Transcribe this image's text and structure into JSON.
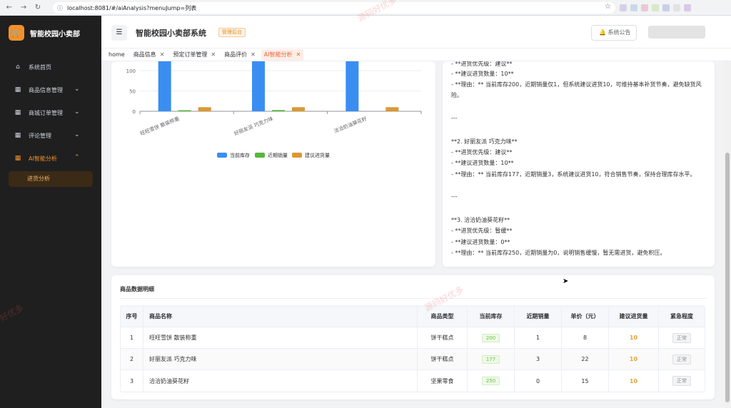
{
  "browser": {
    "url": "localhost:8081/#/aiAnalysis?menuJump=列表"
  },
  "sidebar": {
    "brand": "智能校园小卖部",
    "items": [
      {
        "label": "系统首页",
        "icon": "home-icon"
      },
      {
        "label": "商品信息管理",
        "icon": "grid-icon"
      },
      {
        "label": "商城订单管理",
        "icon": "grid-icon"
      },
      {
        "label": "评论管理",
        "icon": "grid-icon"
      },
      {
        "label": "AI智能分析",
        "icon": "grid-icon"
      }
    ],
    "sub_item": "进货分析"
  },
  "header": {
    "title": "智能校园小卖部系统",
    "badge": "管理后台",
    "notice": "系统公告"
  },
  "tabs": [
    {
      "label": "home"
    },
    {
      "label": "商品信息"
    },
    {
      "label": "预定订单管理"
    },
    {
      "label": "商品评价"
    },
    {
      "label": "AI智能分析"
    }
  ],
  "colors": {
    "accent": "#f0912a",
    "stock": "#3a8ef2",
    "sales": "#56b83b",
    "suggest": "#db9832"
  },
  "chart_data": {
    "type": "bar",
    "categories": [
      "旺旺雪饼 散装称重",
      "好丽友派 巧克力味",
      "洽洽奶油葵花籽"
    ],
    "series": [
      {
        "name": "当前库存",
        "values": [
          200,
          177,
          250
        ]
      },
      {
        "name": "近期销量",
        "values": [
          1,
          3,
          0
        ]
      },
      {
        "name": "建议进货量",
        "values": [
          10,
          10,
          10
        ]
      }
    ],
    "y_ticks": [
      "0",
      "50",
      "100"
    ],
    "ylim": [
      0,
      250
    ],
    "legend": "bottom"
  },
  "advice": {
    "lines": [
      "- **进货优先级：建议**",
      "- **建议进货数量：10**",
      "- **理由：** 当前库存200，近期销量仅1，但系统建议进货10，可维持基本补货节奏，避免缺货风",
      "险。",
      "---",
      "**2. 好丽友派 巧克力味**",
      "- **进货优先级：建议**",
      "- **建议进货数量：10**",
      "- **理由：** 当前库存177，近期销量3，系统建议进货10，符合销售节奏，保持合理库存水平。",
      "---",
      "**3. 洽洽奶油葵花籽**",
      "- **进货优先级：暂缓**",
      "- **建议进货数量：0**",
      "- **理由：** 当前库存250，近期销量为0，说明销售缓慢，暂无需进货，避免积压。"
    ]
  },
  "detail": {
    "title": "商品数据明细",
    "headers": [
      "序号",
      "商品名称",
      "商品类型",
      "当前库存",
      "近期销量",
      "单价（元）",
      "建议进货量",
      "紧急程度"
    ],
    "rows": [
      {
        "no": "1",
        "name": "旺旺雪饼 散装称重",
        "type": "饼干糕点",
        "stock": "200",
        "sales": "1",
        "price": "8",
        "suggest": "10",
        "urgency": "正常"
      },
      {
        "no": "2",
        "name": "好丽友派 巧克力味",
        "type": "饼干糕点",
        "stock": "177",
        "sales": "3",
        "price": "22",
        "suggest": "10",
        "urgency": "正常"
      },
      {
        "no": "3",
        "name": "洽洽奶油葵花籽",
        "type": "坚果零食",
        "stock": "250",
        "sales": "0",
        "price": "15",
        "suggest": "10",
        "urgency": "正常"
      }
    ]
  },
  "watermarks": [
    "源码好优多",
    "好优多",
    "源码好优多"
  ]
}
